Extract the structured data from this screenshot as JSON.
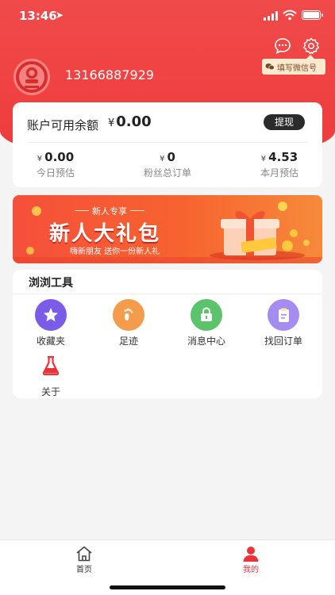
{
  "status": {
    "time": "13:46"
  },
  "header": {
    "phone": "13166887929",
    "wechat_tip": "填写微信号"
  },
  "balance": {
    "label": "账户可用余额",
    "currency": "¥",
    "amount": "0.00",
    "withdraw_label": "提现",
    "stats": [
      {
        "currency": "¥",
        "value": "0.00",
        "label": "今日预估"
      },
      {
        "currency": "¥",
        "value": "0",
        "label": "粉丝总订单"
      },
      {
        "currency": "¥",
        "value": "4.53",
        "label": "本月预估"
      }
    ]
  },
  "banner": {
    "tag": "新人专享",
    "title": "新人大礼包",
    "subtitle": "嗨新朋友 送你一份新人礼"
  },
  "tools": {
    "title": "浏浏工具",
    "items": [
      {
        "label": "收藏夹",
        "icon": "star-icon",
        "color": "#7a5ce8"
      },
      {
        "label": "足迹",
        "icon": "footprint-icon",
        "color": "#f59b4c"
      },
      {
        "label": "消息中心",
        "icon": "lock-icon",
        "color": "#5bc36a"
      },
      {
        "label": "找回订单",
        "icon": "clipboard-icon",
        "color": "#a58cf0"
      },
      {
        "label": "关于",
        "icon": "flask-icon",
        "color": "#e8333a"
      }
    ]
  },
  "tabbar": {
    "items": [
      {
        "label": "首页",
        "icon": "home-icon"
      },
      {
        "label": "我的",
        "icon": "user-icon"
      }
    ],
    "active_color": "#e8333a"
  }
}
